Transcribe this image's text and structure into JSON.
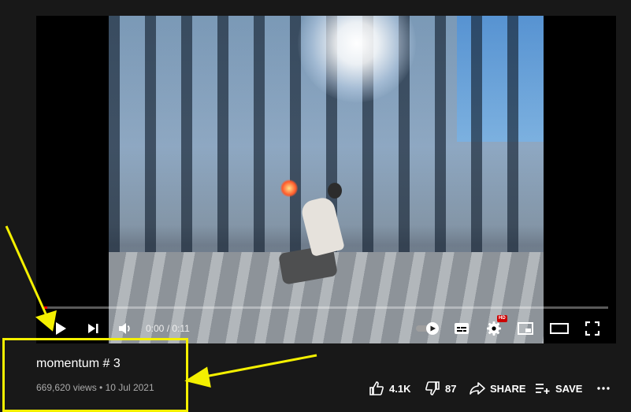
{
  "player": {
    "time_display": "0:00 / 0:11",
    "progress_fraction": 0.005,
    "hd_badge": "HD",
    "colors": {
      "progress": "#ff0000",
      "hd": "#cc0000"
    }
  },
  "video": {
    "title": "momentum # 3",
    "stats": "669,620 views • 10 Jul 2021"
  },
  "actions": {
    "like_count": "4.1K",
    "dislike_count": "87",
    "share_label": "SHARE",
    "save_label": "SAVE"
  },
  "annotation": {
    "color": "#f4f000"
  }
}
